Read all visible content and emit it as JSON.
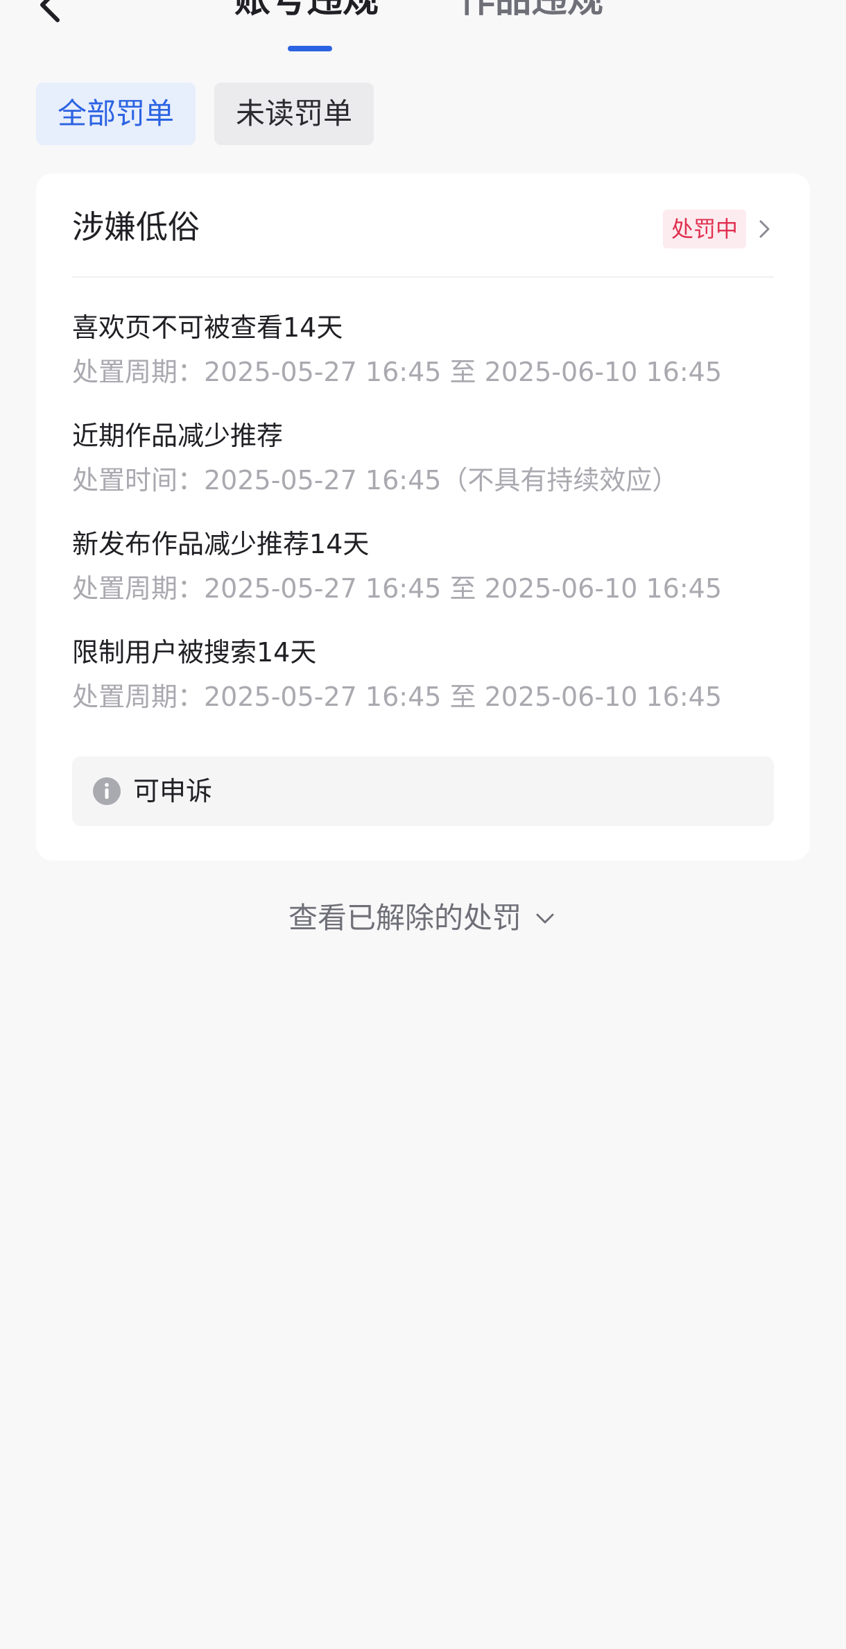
{
  "header": {
    "tabs": [
      {
        "label": "账号违规",
        "active": true
      },
      {
        "label": "作品违规",
        "active": false
      }
    ]
  },
  "filters": {
    "all_label": "全部罚单",
    "unread_label": "未读罚单",
    "selected": "全部罚单"
  },
  "card": {
    "title": "涉嫌低俗",
    "status": "处罚中",
    "penalties": [
      {
        "name": "喜欢页不可被查看14天",
        "period": "处置周期：2025-05-27 16:45 至 2025-06-10 16:45"
      },
      {
        "name": "近期作品减少推荐",
        "period": "处置时间：2025-05-27 16:45（不具有持续效应）"
      },
      {
        "name": "新发布作品减少推荐14天",
        "period": "处置周期：2025-05-27 16:45 至 2025-06-10 16:45"
      },
      {
        "name": "限制用户被搜索14天",
        "period": "处置周期：2025-05-27 16:45 至 2025-06-10 16:45"
      }
    ],
    "appeal_label": "可申诉"
  },
  "footer": {
    "view_released_label": "查看已解除的处罚"
  },
  "colors": {
    "accent": "#2b63e2",
    "status_red": "#e0304f",
    "background": "#f8f8f9"
  },
  "icons": {
    "back": "back-arrow-icon",
    "status_chevron": "chevron-right-icon",
    "appeal": "info-icon",
    "expand": "chevron-down-icon"
  }
}
